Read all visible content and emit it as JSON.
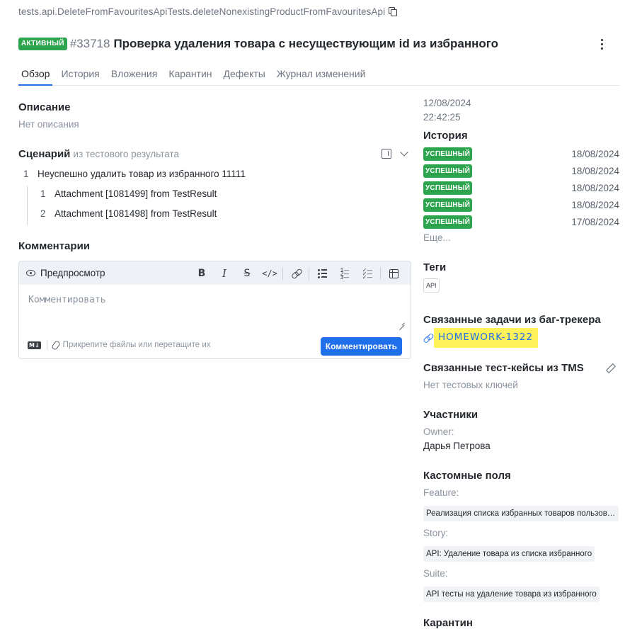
{
  "header": {
    "path": "tests.api.DeleteFromFavouritesApiTests.deleteNonexistingProductFromFavouritesApi",
    "status": "АКТИВНЫЙ",
    "id": "#33718",
    "title": "Проверка удаления товара с несуществующим id из избранного"
  },
  "tabs": [
    "Обзор",
    "История",
    "Вложения",
    "Карантин",
    "Дефекты",
    "Журнал изменений"
  ],
  "description": {
    "title": "Описание",
    "empty": "Нет описания"
  },
  "scenario": {
    "title": "Сценарий",
    "subtitle": "из тестового результата",
    "step": {
      "num": "1",
      "text": "Неуспешно удалить товар из избранного 11111"
    },
    "substeps": [
      {
        "num": "1",
        "text": "Attachment [1081499] from TestResult"
      },
      {
        "num": "2",
        "text": "Attachment [1081498] from TestResult"
      }
    ]
  },
  "comments": {
    "title": "Комментарии",
    "preview": "Предпросмотр",
    "placeholder": "Комментировать",
    "md": "M↓",
    "attach_hint": "Прикрепите файлы или перетащите их",
    "submit": "Комментировать"
  },
  "sidebar": {
    "date": "12/08/2024",
    "time": "22:42:25",
    "history_title": "История",
    "history": [
      {
        "status": "УСПЕШНЫЙ",
        "date": "18/08/2024"
      },
      {
        "status": "УСПЕШНЫЙ",
        "date": "18/08/2024"
      },
      {
        "status": "УСПЕШНЫЙ",
        "date": "18/08/2024"
      },
      {
        "status": "УСПЕШНЫЙ",
        "date": "18/08/2024"
      },
      {
        "status": "УСПЕШНЫЙ",
        "date": "17/08/2024"
      }
    ],
    "more": "Еще...",
    "tags_title": "Теги",
    "tag": "API",
    "issues_title": "Связанные задачи из баг-трекера",
    "issue": "HOMEWORK-1322",
    "tms_title": "Связанные тест-кейсы из TMS",
    "tms_empty": "Нет тестовых ключей",
    "participants_title": "Участники",
    "owner_label": "Owner:",
    "owner": "Дарья Петрова",
    "custom_title": "Кастомные поля",
    "feature_label": "Feature:",
    "feature": "Реализация списка избранных товаров пользователя",
    "story_label": "Story:",
    "story": "API: Удаление товара из списка избранного",
    "suite_label": "Suite:",
    "suite": "API тесты на удаление товара из избранного",
    "quarantine_title": "Карантин"
  },
  "colors": {
    "passed": "#2da44e",
    "primary": "#1f6feb",
    "highlight": "#fff25a"
  }
}
